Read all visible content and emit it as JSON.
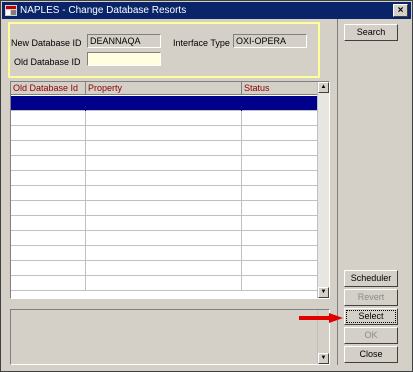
{
  "window": {
    "title": "NAPLES - Change Database Resorts",
    "close_glyph": "×"
  },
  "form": {
    "new_db_label": "New Database ID",
    "new_db_value": "DEANNAQA",
    "interface_label": "Interface Type",
    "interface_value": "OXI-OPERA",
    "old_db_label": "Old Database ID",
    "old_db_value": ""
  },
  "grid": {
    "columns": [
      "Old Database Id",
      "Property",
      "Status"
    ],
    "rows": [
      [
        "",
        "",
        ""
      ],
      [
        "",
        "",
        ""
      ],
      [
        "",
        "",
        ""
      ],
      [
        "",
        "",
        ""
      ],
      [
        "",
        "",
        ""
      ],
      [
        "",
        "",
        ""
      ],
      [
        "",
        "",
        ""
      ],
      [
        "",
        "",
        ""
      ],
      [
        "",
        "",
        ""
      ],
      [
        "",
        "",
        ""
      ],
      [
        "",
        "",
        ""
      ],
      [
        "",
        "",
        ""
      ],
      [
        "",
        "",
        ""
      ]
    ],
    "header_color": "#8b0000",
    "selected_row_color": "#00008b"
  },
  "buttons": {
    "search": "Search",
    "scheduler": "Scheduler",
    "revert": "Revert",
    "select": "Select",
    "ok": "OK",
    "close": "Close"
  },
  "icons": {
    "app": "opera-app-icon",
    "scroll_up": "scroll-up-arrow-icon",
    "scroll_down": "scroll-down-arrow-icon",
    "annotation": "red-pointer-arrow-icon"
  },
  "colors": {
    "titlebar": "#0a246a",
    "highlight_border": "#ffff99",
    "annotation_arrow": "#e00000"
  }
}
